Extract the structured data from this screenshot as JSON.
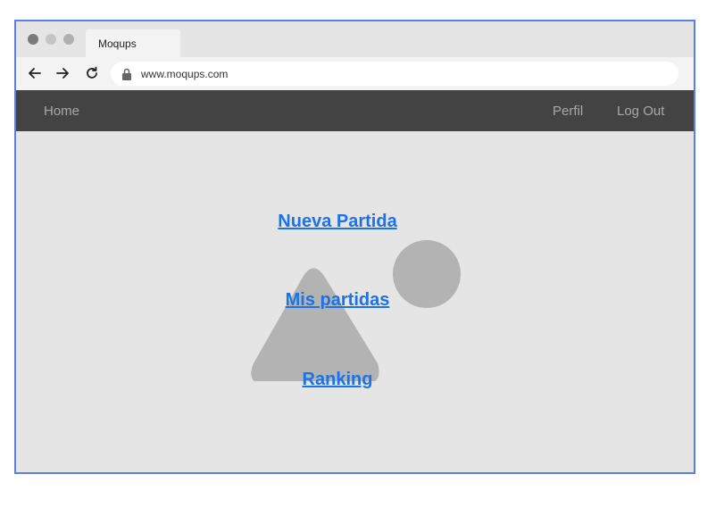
{
  "browser": {
    "tab_title": "Moqups",
    "url": "www.moqups.com",
    "icons": {
      "back": "arrow-left-icon",
      "forward": "arrow-right-icon",
      "reload": "reload-icon",
      "lock": "lock-icon"
    }
  },
  "navbar": {
    "home": "Home",
    "perfil": "Perfil",
    "logout": "Log Out"
  },
  "main": {
    "links": [
      "Nueva Partida",
      "Mis partidas",
      "Ranking"
    ],
    "placeholder_icon": "image-placeholder-icon"
  },
  "colors": {
    "frame_border": "#5b7fe0",
    "navbar_bg": "#434343",
    "link": "#1a73e8",
    "placeholder_shape": "#b3b3b3"
  }
}
